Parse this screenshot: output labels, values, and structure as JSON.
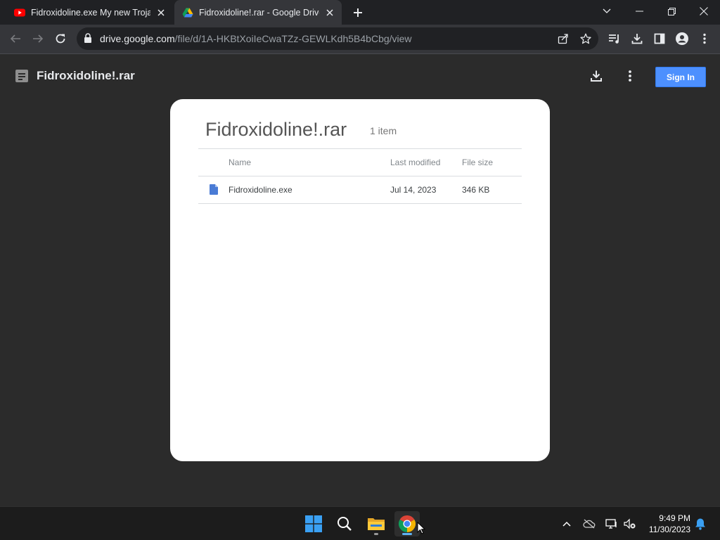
{
  "browser": {
    "tabs": [
      {
        "title": "Fidroxidoline.exe My new Trojan",
        "favicon": "youtube-icon",
        "active": false
      },
      {
        "title": "Fidroxidoline!.rar - Google Drive",
        "favicon": "google-drive-icon",
        "active": true
      }
    ],
    "address": {
      "host": "drive.google.com",
      "path": "/file/d/1A-HKBtXoiIeCwaTZz-GEWLKdh5B4bCbg/view"
    }
  },
  "drive": {
    "header": {
      "file_name": "Fidroxidoline!.rar",
      "signin_label": "Sign In"
    },
    "archive": {
      "title": "Fidroxidoline!.rar",
      "item_count": "1 item",
      "columns": {
        "name": "Name",
        "modified": "Last modified",
        "size": "File size"
      },
      "rows": [
        {
          "name": "Fidroxidoline.exe",
          "modified": "Jul 14, 2023",
          "size": "346 KB"
        }
      ]
    }
  },
  "taskbar": {
    "apps": [
      "windows-start-icon",
      "search-icon",
      "file-explorer-icon",
      "chrome-icon"
    ],
    "clock": {
      "time": "9:49 PM",
      "date": "11/30/2023"
    }
  },
  "colors": {
    "accent_blue": "#4d90fe",
    "chrome_dark": "#202124",
    "page_bg": "#2b2b2b"
  }
}
